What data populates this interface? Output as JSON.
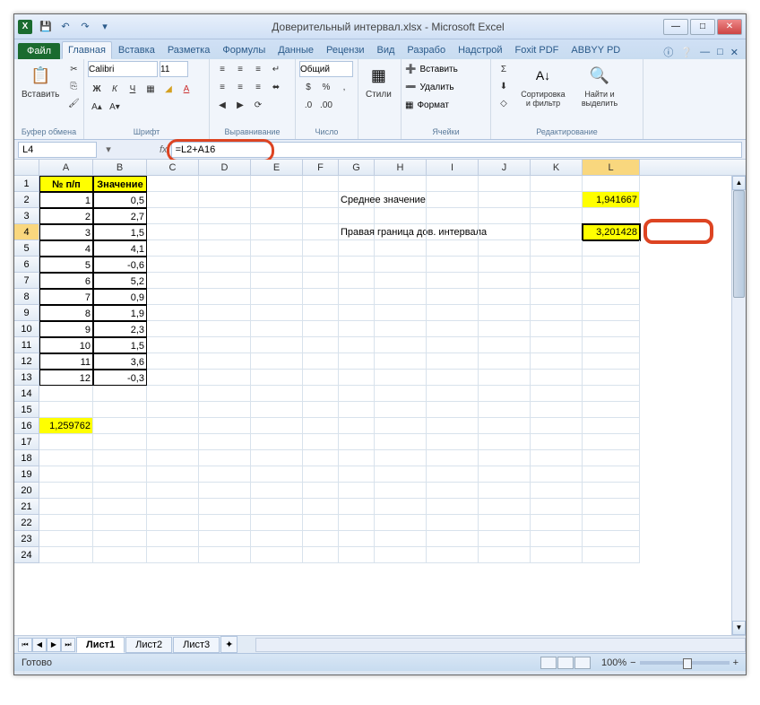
{
  "titlebar": {
    "title": "Доверительный интервал.xlsx - Microsoft Excel"
  },
  "tabs": {
    "file": "Файл",
    "list": [
      "Главная",
      "Вставка",
      "Разметка",
      "Формулы",
      "Данные",
      "Рецензи",
      "Вид",
      "Разрабо",
      "Надстрой",
      "Foxit PDF",
      "ABBYY PD"
    ],
    "active_index": 0
  },
  "ribbon": {
    "clipboard": {
      "paste": "Вставить",
      "label": "Буфер обмена"
    },
    "font": {
      "name": "Calibri",
      "size": "11",
      "label": "Шрифт"
    },
    "alignment": {
      "label": "Выравнивание"
    },
    "number": {
      "format": "Общий",
      "label": "Число"
    },
    "styles": {
      "btn": "Стили"
    },
    "cells": {
      "insert": "Вставить",
      "delete": "Удалить",
      "format": "Формат",
      "label": "Ячейки"
    },
    "editing": {
      "sort": "Сортировка и фильтр",
      "find": "Найти и выделить",
      "label": "Редактирование"
    }
  },
  "formula_bar": {
    "name_box": "L4",
    "formula": "=L2+A16"
  },
  "columns": [
    "A",
    "B",
    "C",
    "D",
    "E",
    "F",
    "G",
    "H",
    "I",
    "J",
    "K",
    "L"
  ],
  "active_col": "L",
  "active_row": 4,
  "headers": {
    "A": "№ п/п",
    "B": "Значение"
  },
  "table_rows": [
    {
      "n": "1",
      "v": "0,5"
    },
    {
      "n": "2",
      "v": "2,7"
    },
    {
      "n": "3",
      "v": "1,5"
    },
    {
      "n": "4",
      "v": "4,1"
    },
    {
      "n": "5",
      "v": "-0,6"
    },
    {
      "n": "6",
      "v": "5,2"
    },
    {
      "n": "7",
      "v": "0,9"
    },
    {
      "n": "8",
      "v": "1,9"
    },
    {
      "n": "9",
      "v": "2,3"
    },
    {
      "n": "10",
      "v": "1,5"
    },
    {
      "n": "11",
      "v": "3,6"
    },
    {
      "n": "12",
      "v": "-0,3"
    }
  ],
  "a16": "1,259762",
  "labels": {
    "mean": "Среднее значение",
    "right_bound": "Правая граница дов. интервала"
  },
  "results": {
    "L2": "1,941667",
    "L4": "3,201428"
  },
  "sheets": {
    "list": [
      "Лист1",
      "Лист2",
      "Лист3"
    ],
    "active": 0
  },
  "statusbar": {
    "ready": "Готово",
    "zoom": "100%"
  }
}
